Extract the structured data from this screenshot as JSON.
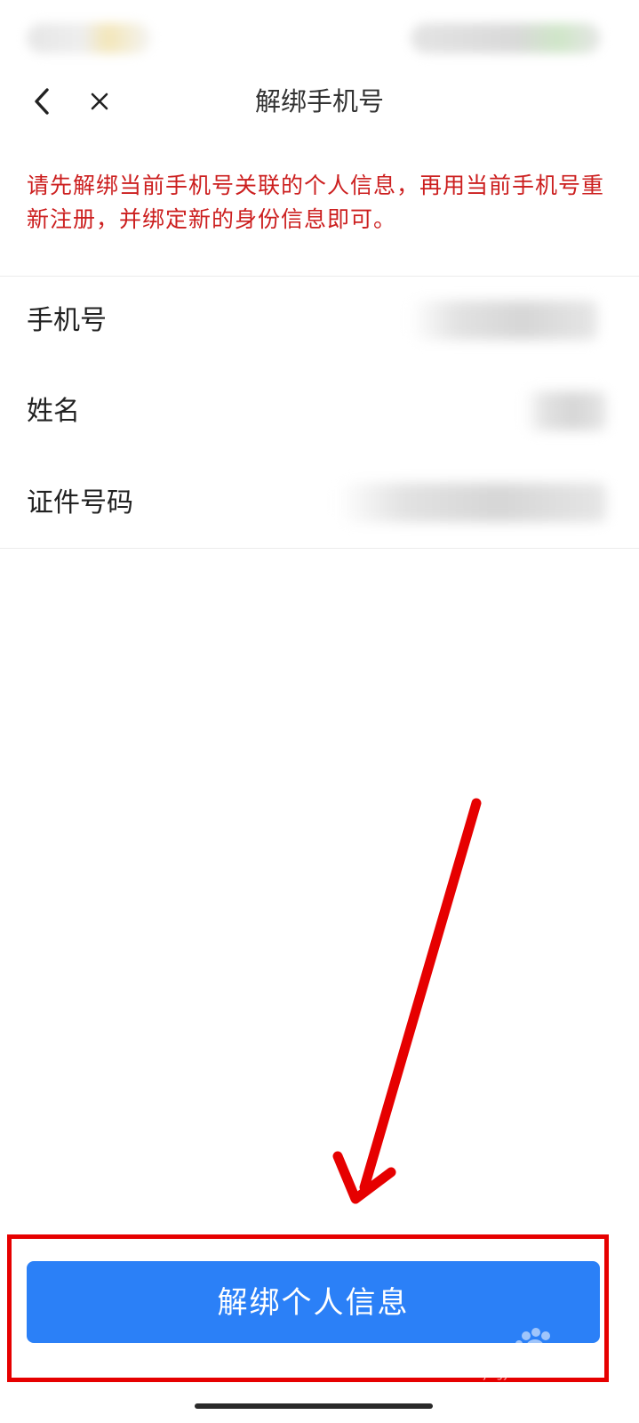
{
  "nav": {
    "title": "解绑手机号",
    "back_icon": "chevron-left-icon",
    "close_icon": "close-icon"
  },
  "warning": {
    "text": "请先解绑当前手机号关联的个人信息，再用当前手机号重新注册，并绑定新的身份信息即可。",
    "color": "#cc1f1f"
  },
  "info": {
    "rows": [
      {
        "label": "手机号"
      },
      {
        "label": "姓名"
      },
      {
        "label": "证件号码"
      }
    ]
  },
  "actions": {
    "unbind_label": "解绑个人信息",
    "button_color": "#2b80f7"
  },
  "annotation": {
    "color": "#e60000"
  },
  "watermark": {
    "text": "jingyan.baidu.com"
  }
}
